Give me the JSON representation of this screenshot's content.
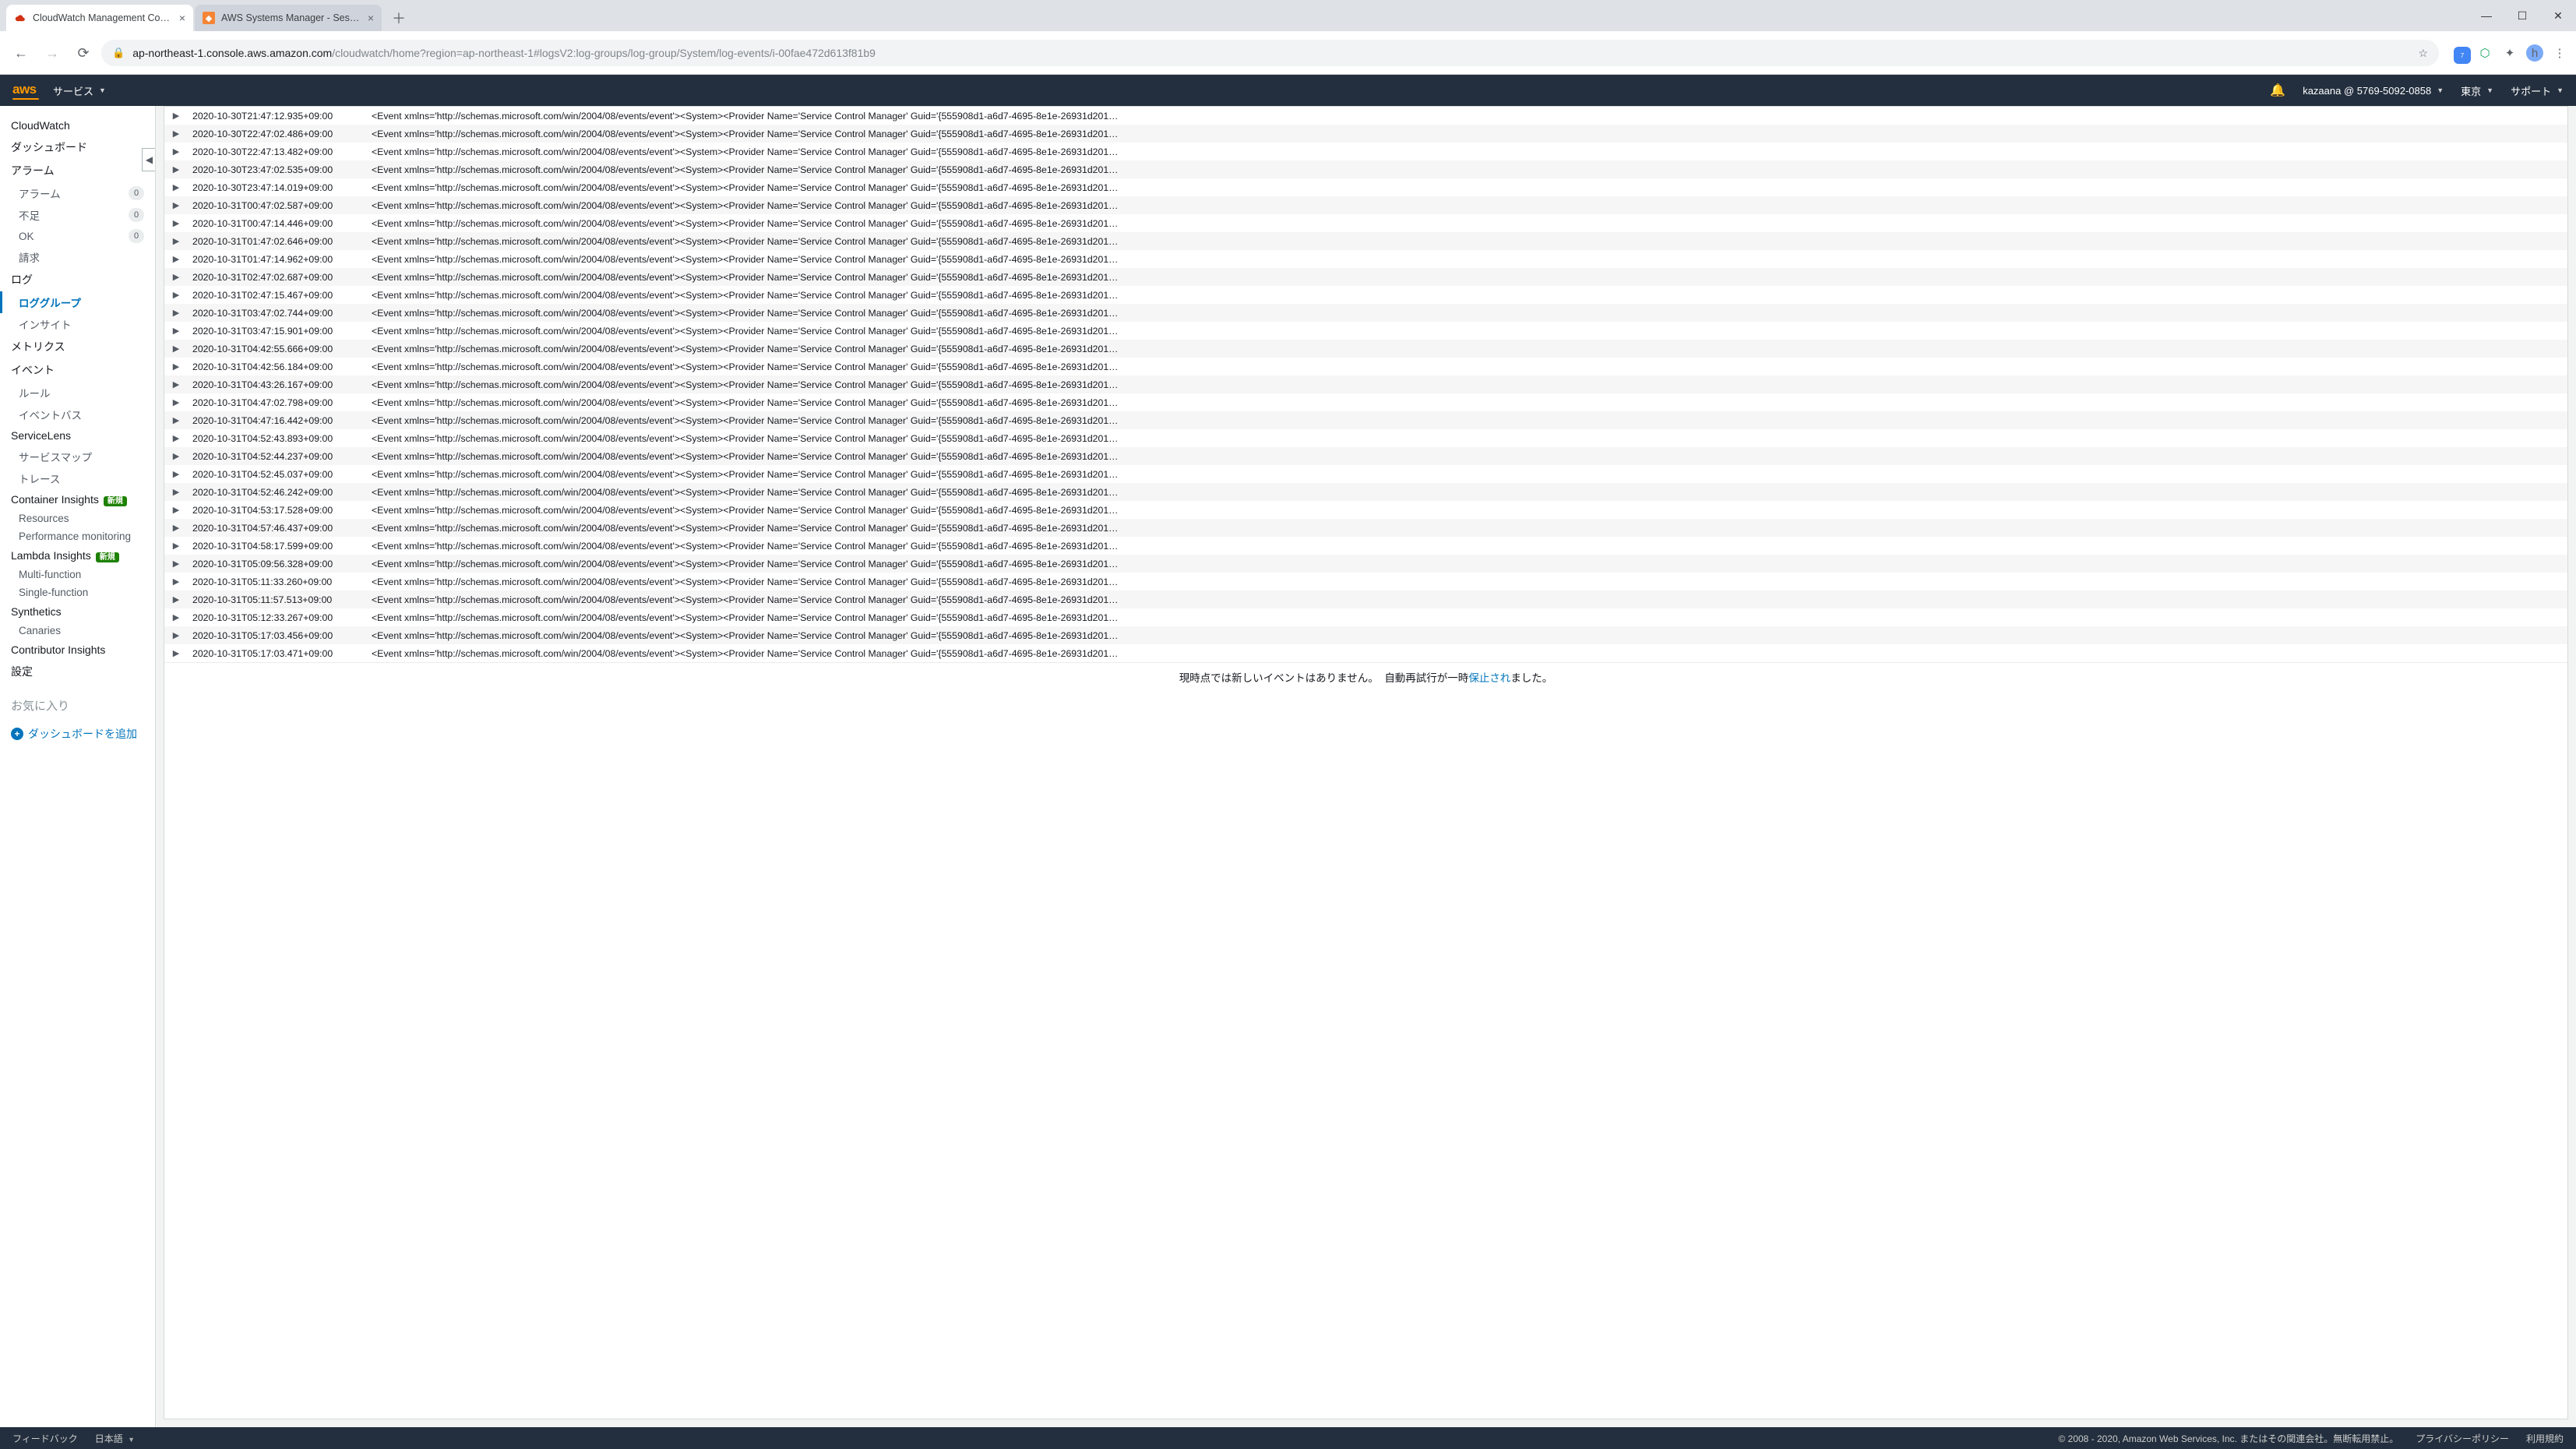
{
  "browser": {
    "tabs": [
      {
        "title": "CloudWatch Management Conso",
        "active": true,
        "favicon_bg": "#fff"
      },
      {
        "title": "AWS Systems Manager - Session",
        "active": false,
        "favicon_bg": "#fff"
      }
    ],
    "url_host": "ap-northeast-1.console.aws.amazon.com",
    "url_path": "/cloudwatch/home?region=ap-northeast-1#logsV2:log-groups/log-group/System/log-events/i-00fae472d613f81b9",
    "avatar_letter": "h",
    "ext_badge": "7"
  },
  "awsnav": {
    "services": "サービス",
    "user": "kazaana @ 5769-5092-0858",
    "region": "東京",
    "support": "サポート"
  },
  "sidebar": {
    "cloudwatch": "CloudWatch",
    "dashboard": "ダッシュボード",
    "alarm": "アラーム",
    "alarm_sub": [
      {
        "label": "アラーム",
        "count": "0"
      },
      {
        "label": "不足",
        "count": "0"
      },
      {
        "label": "OK",
        "count": "0"
      },
      {
        "label": "請求"
      }
    ],
    "log": "ログ",
    "log_groups": "ロググループ",
    "insight": "インサイト",
    "metrics": "メトリクス",
    "events": "イベント",
    "rules": "ルール",
    "event_bus": "イベントバス",
    "servicelens": "ServiceLens",
    "service_map": "サービスマップ",
    "trace": "トレース",
    "container_insights": "Container Insights",
    "resources": "Resources",
    "perf": "Performance monitoring",
    "lambda_insights": "Lambda Insights",
    "multi": "Multi-function",
    "single": "Single-function",
    "synth": "Synthetics",
    "canaries": "Canaries",
    "contrib": "Contributor Insights",
    "settings": "設定",
    "favorites": "お気に入り",
    "add_dash": "ダッシュボードを追加",
    "new_pill": "新規"
  },
  "log_message": "<Event xmlns='http://schemas.microsoft.com/win/2004/08/events/event'><System><Provider Name='Service Control Manager' Guid='{555908d1-a6d7-4695-8e1e-26931d201…",
  "log_rows": [
    "2020-10-30T21:47:12.935+09:00",
    "2020-10-30T22:47:02.486+09:00",
    "2020-10-30T22:47:13.482+09:00",
    "2020-10-30T23:47:02.535+09:00",
    "2020-10-30T23:47:14.019+09:00",
    "2020-10-31T00:47:02.587+09:00",
    "2020-10-31T00:47:14.446+09:00",
    "2020-10-31T01:47:02.646+09:00",
    "2020-10-31T01:47:14.962+09:00",
    "2020-10-31T02:47:02.687+09:00",
    "2020-10-31T02:47:15.467+09:00",
    "2020-10-31T03:47:02.744+09:00",
    "2020-10-31T03:47:15.901+09:00",
    "2020-10-31T04:42:55.666+09:00",
    "2020-10-31T04:42:56.184+09:00",
    "2020-10-31T04:43:26.167+09:00",
    "2020-10-31T04:47:02.798+09:00",
    "2020-10-31T04:47:16.442+09:00",
    "2020-10-31T04:52:43.893+09:00",
    "2020-10-31T04:52:44.237+09:00",
    "2020-10-31T04:52:45.037+09:00",
    "2020-10-31T04:52:46.242+09:00",
    "2020-10-31T04:53:17.528+09:00",
    "2020-10-31T04:57:46.437+09:00",
    "2020-10-31T04:58:17.599+09:00",
    "2020-10-31T05:09:56.328+09:00",
    "2020-10-31T05:11:33.260+09:00",
    "2020-10-31T05:11:57.513+09:00",
    "2020-10-31T05:12:33.267+09:00",
    "2020-10-31T05:17:03.456+09:00",
    "2020-10-31T05:17:03.471+09:00"
  ],
  "log_footer": {
    "no_new": "現時点では新しいイベントはありません。",
    "retry_pre": "自動再試行が一時",
    "retry_link": "保止され",
    "retry_post": "ました。"
  },
  "footer": {
    "feedback": "フィードバック",
    "lang": "日本語",
    "copyright": "© 2008 - 2020, Amazon Web Services, Inc. またはその関連会社。無断転用禁止。",
    "privacy": "プライバシーポリシー",
    "terms": "利用規約"
  }
}
